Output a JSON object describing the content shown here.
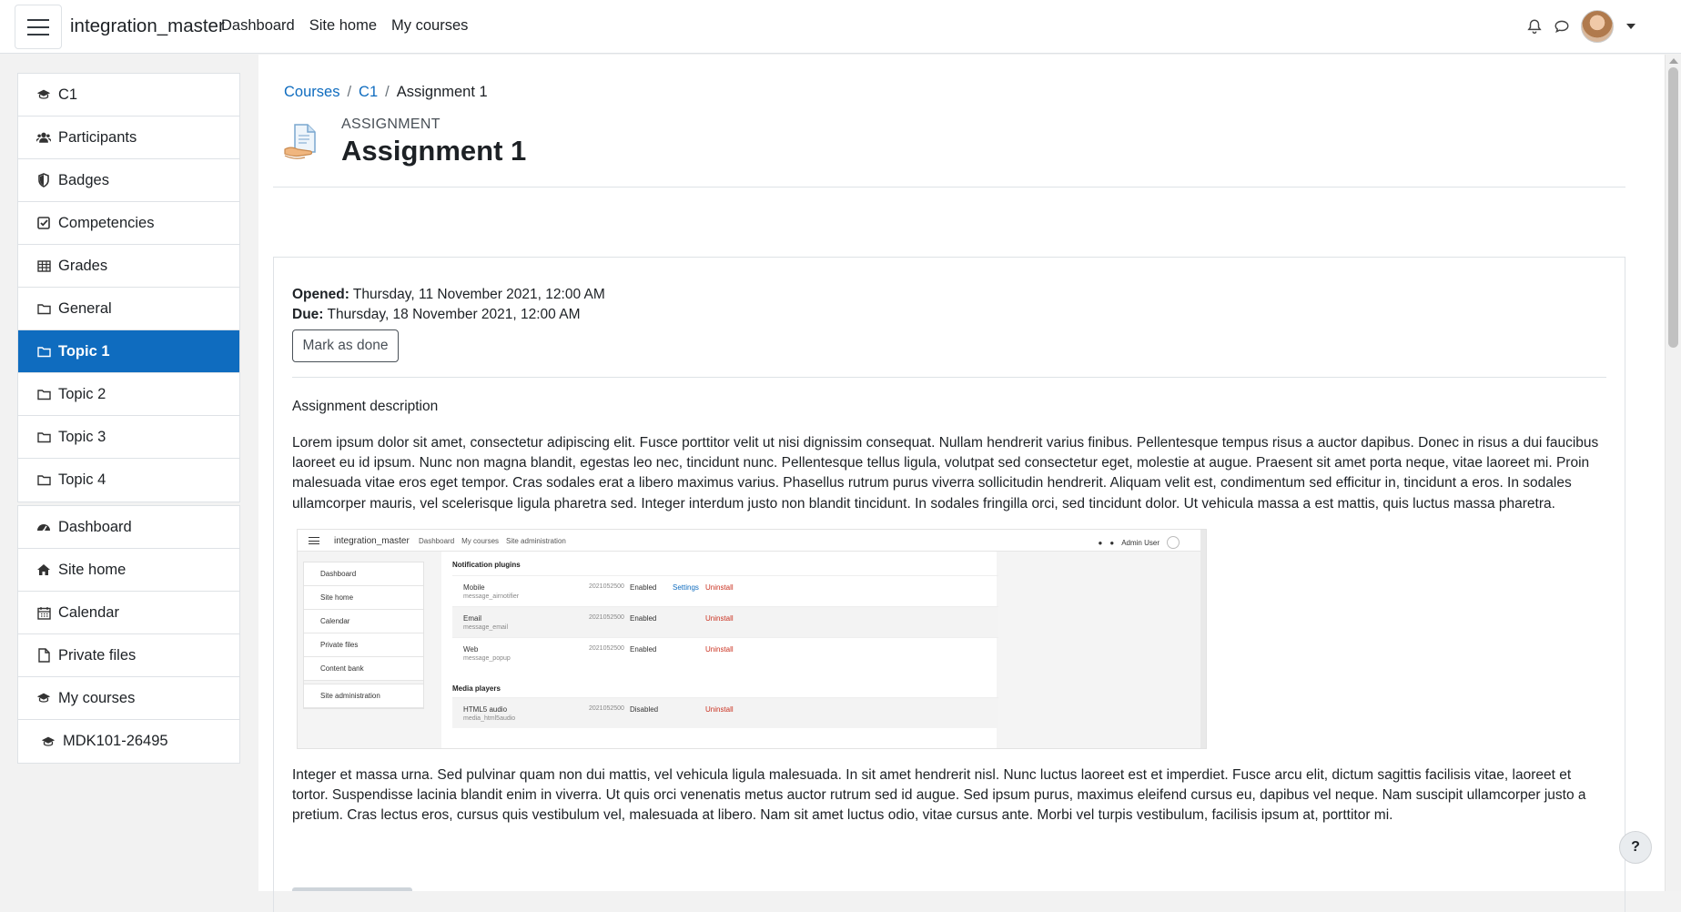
{
  "navbar": {
    "brand": "integration_master",
    "links": [
      "Dashboard",
      "Site home",
      "My courses"
    ],
    "icons": [
      "bell-icon",
      "chat-icon"
    ]
  },
  "drawer": {
    "course_items": [
      {
        "label": "C1",
        "icon": "graduation-cap-icon"
      },
      {
        "label": "Participants",
        "icon": "users-icon"
      },
      {
        "label": "Badges",
        "icon": "shield-icon"
      },
      {
        "label": "Competencies",
        "icon": "check-square-icon"
      },
      {
        "label": "Grades",
        "icon": "table-icon"
      },
      {
        "label": "General",
        "icon": "folder-icon"
      },
      {
        "label": "Topic 1",
        "icon": "folder-icon",
        "active": true
      },
      {
        "label": "Topic 2",
        "icon": "folder-icon"
      },
      {
        "label": "Topic 3",
        "icon": "folder-icon"
      },
      {
        "label": "Topic 4",
        "icon": "folder-icon"
      }
    ],
    "site_items": [
      {
        "label": "Dashboard",
        "icon": "tachometer-icon"
      },
      {
        "label": "Site home",
        "icon": "home-icon"
      },
      {
        "label": "Calendar",
        "icon": "calendar-icon"
      },
      {
        "label": "Private files",
        "icon": "file-icon"
      },
      {
        "label": "My courses",
        "icon": "graduation-cap-icon"
      },
      {
        "label": "MDK101-26495",
        "icon": "graduation-cap-icon"
      }
    ]
  },
  "breadcrumb": [
    "Courses",
    "C1",
    "Assignment 1"
  ],
  "page": {
    "kicker": "ASSIGNMENT",
    "title": "Assignment 1",
    "opened_label": "Opened:",
    "opened_value": "Thursday, 11 November 2021, 12:00 AM",
    "due_label": "Due:",
    "due_value": "Thursday, 18 November 2021, 12:00 AM",
    "mark_done": "Mark as done",
    "description_title": "Assignment description",
    "paragraph1": "Lorem ipsum dolor sit amet, consectetur adipiscing elit. Fusce porttitor velit ut nisi dignissim consequat. Nullam hendrerit varius finibus. Pellentesque tempus risus a auctor dapibus. Donec in risus a dui faucibus laoreet eu id ipsum. Nunc non magna blandit, egestas leo nec, tincidunt nunc. Pellentesque tellus ligula, volutpat sed consectetur eget, molestie at augue. Praesent sit amet porta neque, vitae laoreet mi. Proin malesuada vitae eros eget tempor. Cras sodales erat a libero maximus varius. Phasellus rutrum purus viverra sollicitudin hendrerit. Aliquam velit est, condimentum sed efficitur in, tincidunt a eros. In sodales ullamcorper mauris, vel scelerisque ligula pharetra sed. Integer interdum justo non blandit tincidunt. In sodales fringilla orci, sed tincidunt dolor. Ut vehicula massa a est mattis, quis luctus massa pharetra.",
    "paragraph2": "Integer et massa urna. Sed pulvinar quam non dui mattis, vel vehicula ligula malesuada. In sit amet hendrerit nisl. Nunc luctus laoreet est et imperdiet. Fusce arcu elit, dictum sagittis facilisis vitae, laoreet et tortor. Suspendisse lacinia blandit enim in viverra. Ut quis orci venenatis metus auctor rutrum sed id augue. Sed ipsum purus, maximus eleifend cursus eu, dapibus vel neque. Nam suscipit ullamcorper justo a pretium. Cras lectus eros, cursus quis vestibulum vel, malesuada at libero. Nam sit amet luctus odio, vitae cursus ante. Morbi vel turpis vestibulum, facilisis ipsum at, porttitor mi."
  },
  "screenshot": {
    "brand": "integration_master",
    "links": [
      "Dashboard",
      "My courses",
      "Site administration"
    ],
    "user": "Admin User",
    "side": [
      "Dashboard",
      "Site home",
      "Calendar",
      "Private files",
      "Content bank",
      "Site administration"
    ],
    "section1": "Notification plugins",
    "section2": "Media players",
    "rows": [
      {
        "name": "Mobile",
        "sub": "message_airnotifier",
        "version": "2021052500",
        "status": "Enabled",
        "settings": "Settings",
        "action": "Uninstall"
      },
      {
        "name": "Email",
        "sub": "message_email",
        "version": "2021052500",
        "status": "Enabled",
        "settings": "",
        "action": "Uninstall"
      },
      {
        "name": "Web",
        "sub": "message_popup",
        "version": "2021052500",
        "status": "Enabled",
        "settings": "",
        "action": "Uninstall"
      },
      {
        "name": "HTML5 audio",
        "sub": "media_html5audio",
        "version": "2021052500",
        "status": "Disabled",
        "settings": "",
        "action": "Uninstall"
      }
    ]
  },
  "help": "?",
  "colors": {
    "primary": "#0f6cbf",
    "danger": "#ca3120"
  }
}
